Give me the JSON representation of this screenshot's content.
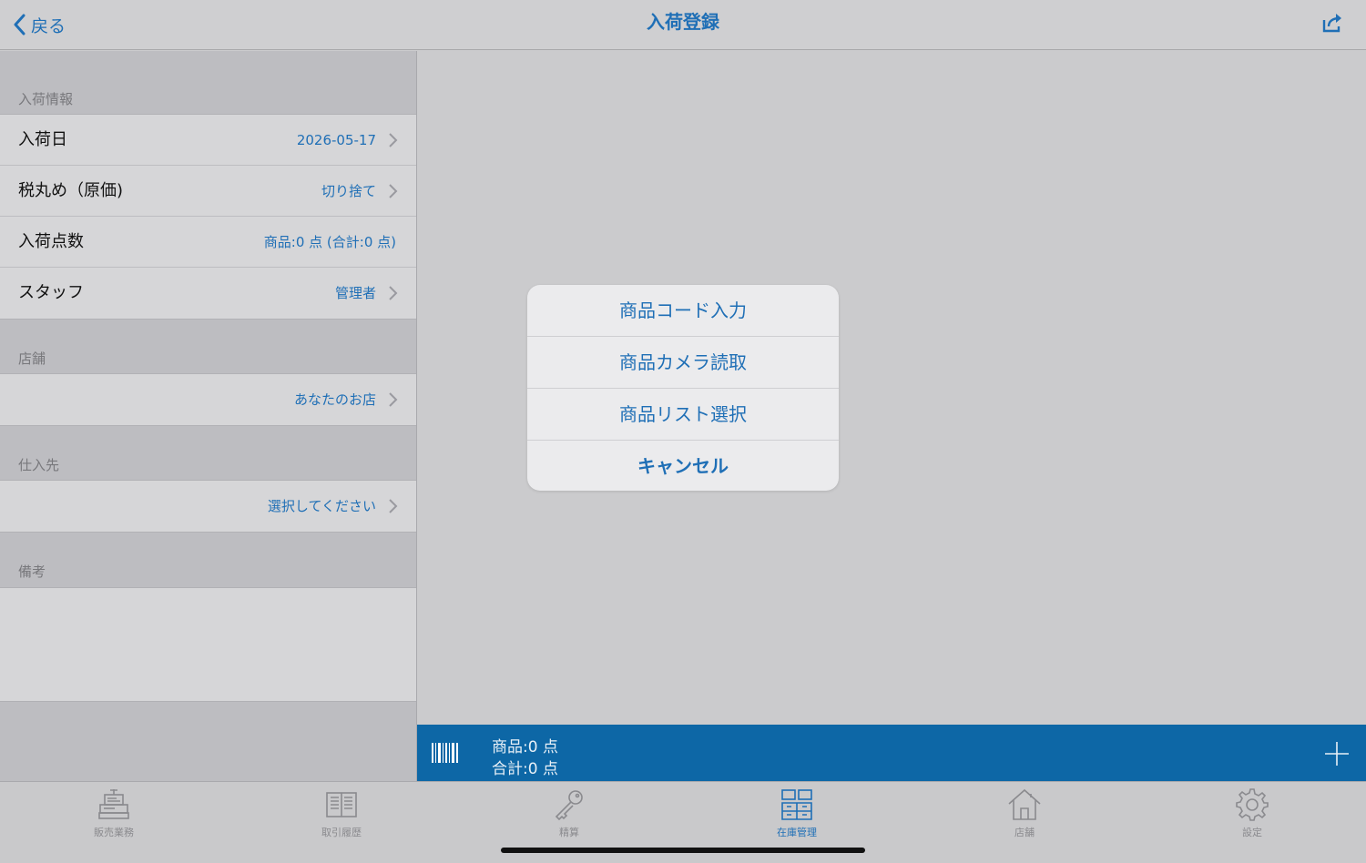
{
  "nav": {
    "back_label": "戻る",
    "title": "入荷登録",
    "share_icon": "share-icon"
  },
  "sections": {
    "info_header": "入荷情報",
    "store_header": "店舗",
    "supplier_header": "仕入先",
    "memo_header": "備考"
  },
  "info_rows": [
    {
      "label": "入荷日",
      "value": "2026-05-17"
    },
    {
      "label": "税丸め（原価)",
      "value": "切り捨て"
    },
    {
      "label": "入荷点数",
      "value": "商品:0 点 (合計:0 点)"
    },
    {
      "label": "スタッフ",
      "value": "管理者"
    }
  ],
  "store_value": "あなたのお店",
  "supplier_value": "選択してください",
  "action_sheet": {
    "items": [
      "商品コード入力",
      "商品カメラ読取",
      "商品リスト選択"
    ],
    "cancel": "キャンセル"
  },
  "bottom_bar": {
    "items_text": "商品:0 点",
    "total_text": "合計:0 点"
  },
  "tabs": [
    {
      "label": "販売業務",
      "icon": "cash-register-icon"
    },
    {
      "label": "取引履歴",
      "icon": "book-icon"
    },
    {
      "label": "精算",
      "icon": "key-icon"
    },
    {
      "label": "在庫管理",
      "icon": "inventory-icon",
      "active": true
    },
    {
      "label": "店舗",
      "icon": "house-icon"
    },
    {
      "label": "設定",
      "icon": "gear-icon"
    }
  ],
  "colors": {
    "accent": "#1f6fb6",
    "bar": "#0d67a6"
  }
}
